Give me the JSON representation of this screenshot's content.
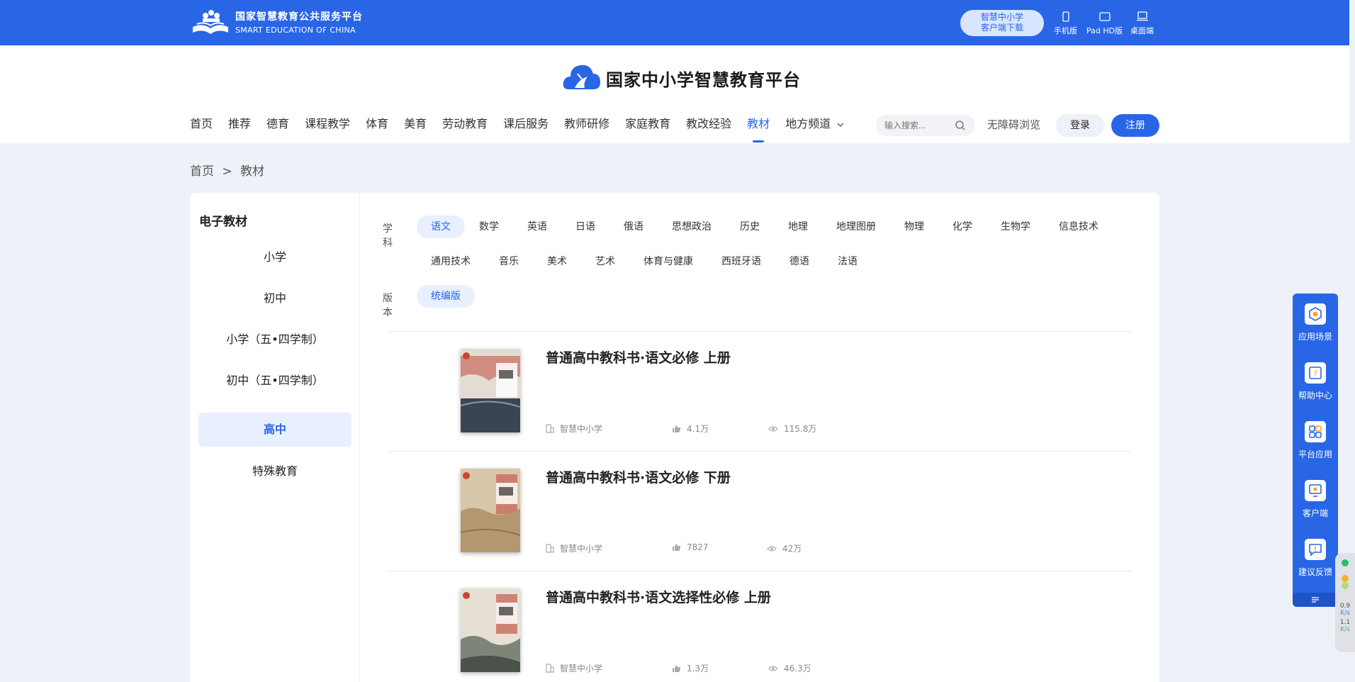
{
  "topbar": {
    "logo_cn": "国家智慧教育公共服务平台",
    "logo_en": "SMART EDUCATION OF CHINA",
    "download_line1": "智慧中小学",
    "download_line2": "客户端下载",
    "devices": [
      "手机版",
      "Pad HD版",
      "桌面端"
    ]
  },
  "header": {
    "brand": "国家中小学智慧教育平台",
    "nav": [
      "首页",
      "推荐",
      "德育",
      "课程教学",
      "体育",
      "美育",
      "劳动教育",
      "课后服务",
      "教师研修",
      "家庭教育",
      "教改经验",
      "教材",
      "地方频道"
    ],
    "active_nav": "教材",
    "search_placeholder": "输入搜索...",
    "accessibility": "无障碍浏览",
    "login": "登录",
    "register": "注册"
  },
  "breadcrumb": [
    "首页",
    ">",
    "教材"
  ],
  "left_panel": {
    "title": "电子教材",
    "stages": [
      "小学",
      "初中",
      "小学（五•四学制）",
      "初中（五•四学制）",
      "高中",
      "特殊教育"
    ],
    "active_stage": "高中"
  },
  "filters": {
    "subject_label": "学科",
    "subjects_row1": [
      "语文",
      "数学",
      "英语",
      "日语",
      "俄语",
      "思想政治",
      "历史",
      "地理",
      "地理图册",
      "物理",
      "化学",
      "生物学",
      "信息技术"
    ],
    "subjects_row2": [
      "通用技术",
      "音乐",
      "美术",
      "艺术",
      "体育与健康",
      "西班牙语",
      "德语",
      "法语"
    ],
    "active_subject": "语文",
    "version_label": "版本",
    "versions": [
      "统编版"
    ],
    "active_version": "统编版"
  },
  "books": [
    {
      "title": "普通高中教科书·语文必修 上册",
      "publisher": "智慧中小学",
      "likes": "4.1万",
      "views": "115.8万"
    },
    {
      "title": "普通高中教科书·语文必修 下册",
      "publisher": "智慧中小学",
      "likes": "7827",
      "views": "42万"
    },
    {
      "title": "普通高中教科书·语文选择性必修 上册",
      "publisher": "智慧中小学",
      "likes": "1.3万",
      "views": "46.3万"
    }
  ],
  "side_toolbar": [
    "应用场景",
    "帮助中心",
    "平台应用",
    "客户端",
    "建议反馈"
  ],
  "speed": {
    "up": "0.9",
    "down": "1.1",
    "unit": "K/s"
  }
}
